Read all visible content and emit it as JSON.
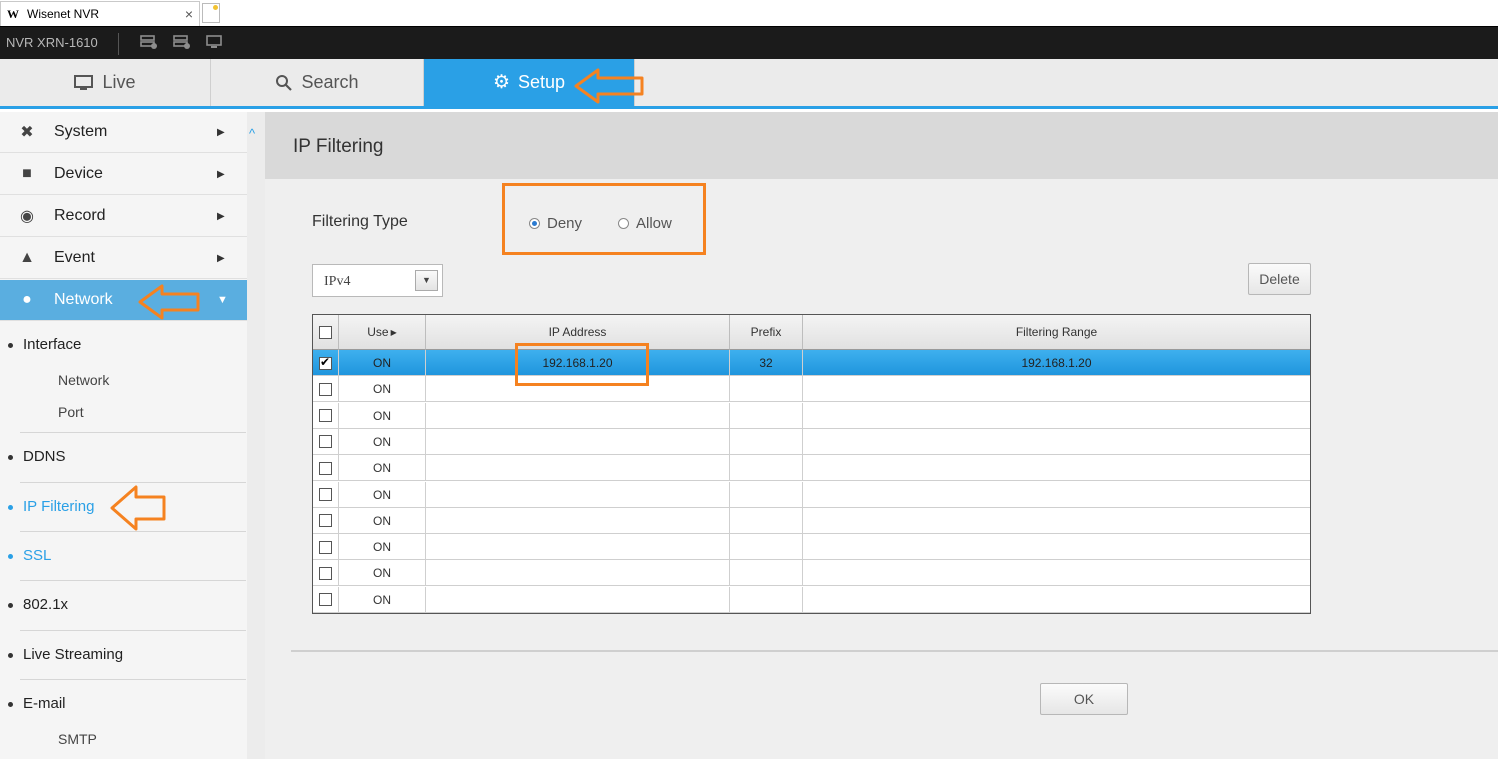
{
  "browser": {
    "tab_title": "Wisenet NVR",
    "tab_logo": "W",
    "close": "×"
  },
  "appbar": {
    "model": "NVR XRN-1610"
  },
  "nav": {
    "live": "Live",
    "search": "Search",
    "setup": "Setup"
  },
  "sidebar": {
    "menu": {
      "system": "System",
      "device": "Device",
      "record": "Record",
      "event": "Event",
      "network": "Network"
    },
    "sub": {
      "interface": "Interface",
      "interface_network": "Network",
      "interface_port": "Port",
      "ddns": "DDNS",
      "ip_filtering": "IP Filtering",
      "ssl": "SSL",
      "dot1x": "802.1x",
      "live_streaming": "Live Streaming",
      "email": "E-mail",
      "smtp": "SMTP"
    }
  },
  "content": {
    "title": "IP Filtering",
    "filtering_type_label": "Filtering Type",
    "radio_deny": "Deny",
    "radio_allow": "Allow",
    "radio_selected": "Deny",
    "ip_version": "IPv4",
    "delete_button": "Delete",
    "ok_button": "OK"
  },
  "table": {
    "headers": {
      "use": "Use",
      "ip": "IP Address",
      "prefix": "Prefix",
      "range": "Filtering Range"
    },
    "rows": [
      {
        "checked": true,
        "use": "ON",
        "ip": "192.168.1.20",
        "prefix": "32",
        "range": "192.168.1.20"
      },
      {
        "checked": false,
        "use": "ON",
        "ip": "",
        "prefix": "",
        "range": ""
      },
      {
        "checked": false,
        "use": "ON",
        "ip": "",
        "prefix": "",
        "range": ""
      },
      {
        "checked": false,
        "use": "ON",
        "ip": "",
        "prefix": "",
        "range": ""
      },
      {
        "checked": false,
        "use": "ON",
        "ip": "",
        "prefix": "",
        "range": ""
      },
      {
        "checked": false,
        "use": "ON",
        "ip": "",
        "prefix": "",
        "range": ""
      },
      {
        "checked": false,
        "use": "ON",
        "ip": "",
        "prefix": "",
        "range": ""
      },
      {
        "checked": false,
        "use": "ON",
        "ip": "",
        "prefix": "",
        "range": ""
      },
      {
        "checked": false,
        "use": "ON",
        "ip": "",
        "prefix": "",
        "range": ""
      },
      {
        "checked": false,
        "use": "ON",
        "ip": "",
        "prefix": "",
        "range": ""
      }
    ]
  },
  "colors": {
    "accent": "#2aa0e6",
    "annotation": "#f58220",
    "sidebar_active": "#5aaee0"
  }
}
